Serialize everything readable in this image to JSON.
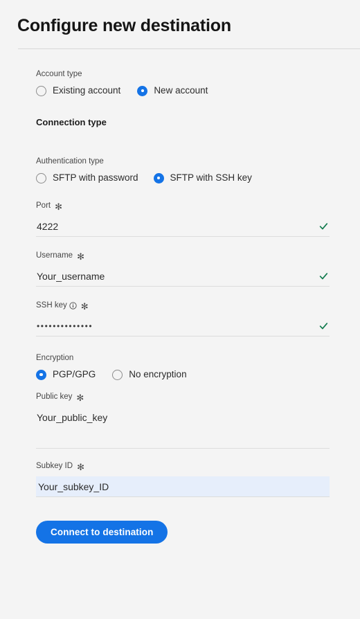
{
  "page": {
    "title": "Configure new destination",
    "background_color": "#f4f4f4",
    "accent_color": "#1473e6",
    "valid_color": "#107a4d",
    "highlight_color": "#e6eefb"
  },
  "account_type": {
    "label": "Account type",
    "options": [
      {
        "label": "Existing account",
        "selected": false
      },
      {
        "label": "New account",
        "selected": true
      }
    ]
  },
  "connection_type": {
    "heading": "Connection type"
  },
  "authentication_type": {
    "label": "Authentication type",
    "options": [
      {
        "label": "SFTP with password",
        "selected": false
      },
      {
        "label": "SFTP with SSH key",
        "selected": true
      }
    ]
  },
  "port": {
    "label": "Port",
    "required_marker": "✻",
    "value": "4222",
    "valid": true,
    "valid_icon": "check-icon"
  },
  "username": {
    "label": "Username",
    "required_marker": "✻",
    "value": "Your_username",
    "valid": true,
    "valid_icon": "check-icon"
  },
  "ssh_key": {
    "label": "SSH key",
    "info_icon": "info-icon",
    "required_marker": "✻",
    "value": "••••••••••••••",
    "valid": true,
    "valid_icon": "check-icon"
  },
  "encryption": {
    "label": "Encryption",
    "options": [
      {
        "label": "PGP/GPG",
        "selected": true
      },
      {
        "label": "No encryption",
        "selected": false
      }
    ]
  },
  "public_key": {
    "label": "Public key",
    "required_marker": "✻",
    "value": "Your_public_key"
  },
  "subkey_id": {
    "label": "Subkey ID",
    "required_marker": "✻",
    "value": "Your_subkey_ID",
    "highlighted": true
  },
  "submit": {
    "label": "Connect to destination"
  }
}
